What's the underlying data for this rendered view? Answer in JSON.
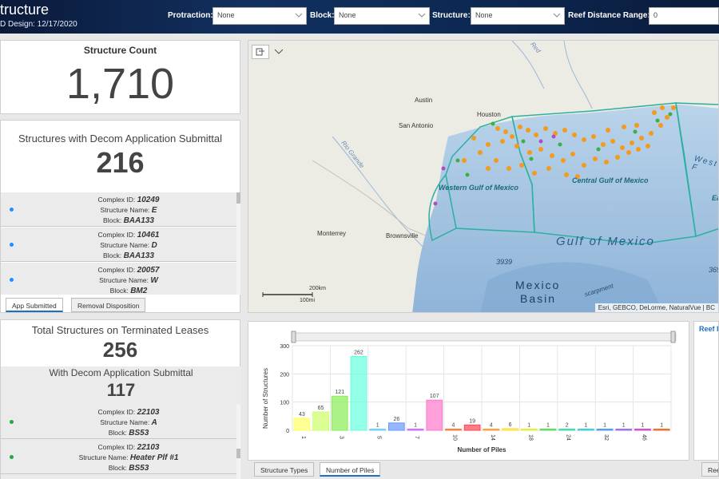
{
  "header": {
    "title": "tructure",
    "subtitle": "D Design: 12/17/2020",
    "filters": [
      {
        "label": "Protraction:",
        "value": "None"
      },
      {
        "label": "Block:",
        "value": "None"
      },
      {
        "label": "Structure:",
        "value": "None"
      },
      {
        "label": "Reef Distance Range:",
        "value": "0"
      }
    ]
  },
  "structure_count": {
    "title": "Structure Count",
    "value": "1,710"
  },
  "decom_submittal": {
    "title": "Structures with Decom Application Submittal",
    "value": "216",
    "items": [
      {
        "complex_label": "Complex ID:",
        "complex_id": "10249",
        "name_label": "Structure Name:",
        "name": "E",
        "block_label": "Block:",
        "block": "BAA133"
      },
      {
        "complex_label": "Complex ID:",
        "complex_id": "10461",
        "name_label": "Structure Name:",
        "name": "D",
        "block_label": "Block:",
        "block": "BAA133"
      },
      {
        "complex_label": "Complex ID:",
        "complex_id": "20057",
        "name_label": "Structure Name:",
        "name": "W",
        "block_label": "Block:",
        "block": "BM2"
      }
    ],
    "tabs": [
      "App Submitted",
      "Removal Disposition"
    ]
  },
  "terminated": {
    "title": "Total Structures on Terminated Leases",
    "value": "256",
    "sub_title": "With Decom Application Submittal",
    "sub_value": "117",
    "items": [
      {
        "complex_label": "Complex ID:",
        "complex_id": "22103",
        "name_label": "Structure Name:",
        "name": "A",
        "block_label": "Block:",
        "block": "BS53"
      },
      {
        "complex_label": "Complex ID:",
        "complex_id": "22103",
        "name_label": "Structure Name:",
        "name": "Heater Plf #1",
        "block_label": "Block:",
        "block": "BS53"
      }
    ]
  },
  "map": {
    "labels": {
      "austin": "Austin",
      "houston": "Houston",
      "san_antonio": "San Antonio",
      "monterrey": "Monterrey",
      "brownsville": "Brownsville",
      "red": "Red",
      "rio_grande": "Rio Grande",
      "western_gulf": "Western Gulf of Mexico",
      "central_gulf": "Central Gulf of Mexico",
      "gulf": "Gulf of Mexico",
      "mexico": "Mexico",
      "basin": "Basin",
      "depth1": "3939",
      "depth2": "369",
      "west": "West F",
      "east": "Ea",
      "escarpment": "scarpment"
    },
    "scale_km": "200km",
    "scale_mi": "100mi",
    "attribution": "Esri, GEBCO, DeLorme, NaturalVue | BC"
  },
  "chart_data": {
    "type": "bar",
    "xlabel": "Number of Piles",
    "ylabel": "Number of Structures",
    "ylim": [
      0,
      300
    ],
    "yticks": [
      0,
      100,
      200,
      300
    ],
    "x_tick_labels": [
      "1",
      "3",
      "5",
      "7",
      "10",
      "14",
      "18",
      "24",
      "32",
      "46"
    ],
    "values": [
      43,
      65,
      121,
      262,
      1,
      26,
      1,
      107,
      4,
      19,
      4,
      6,
      1,
      1,
      2,
      1,
      1,
      1,
      1,
      1
    ],
    "colors": [
      "#ffff66",
      "#ccff66",
      "#88ee55",
      "#66ffdd",
      "#66ccff",
      "#6699ff",
      "#cc66ff",
      "#ff77cc",
      "#ff7733",
      "#ff4455",
      "#ff9933",
      "#ffdd33",
      "#ddee33",
      "#55dd55",
      "#33ddaa",
      "#33ccdd",
      "#4499ee",
      "#9966ee",
      "#cc44cc",
      "#ee6622"
    ],
    "grid": true
  },
  "chart_tabs": [
    "Structure Types",
    "Number of Piles"
  ],
  "right_panel": {
    "title": "Reef I",
    "tab": "Ree"
  }
}
